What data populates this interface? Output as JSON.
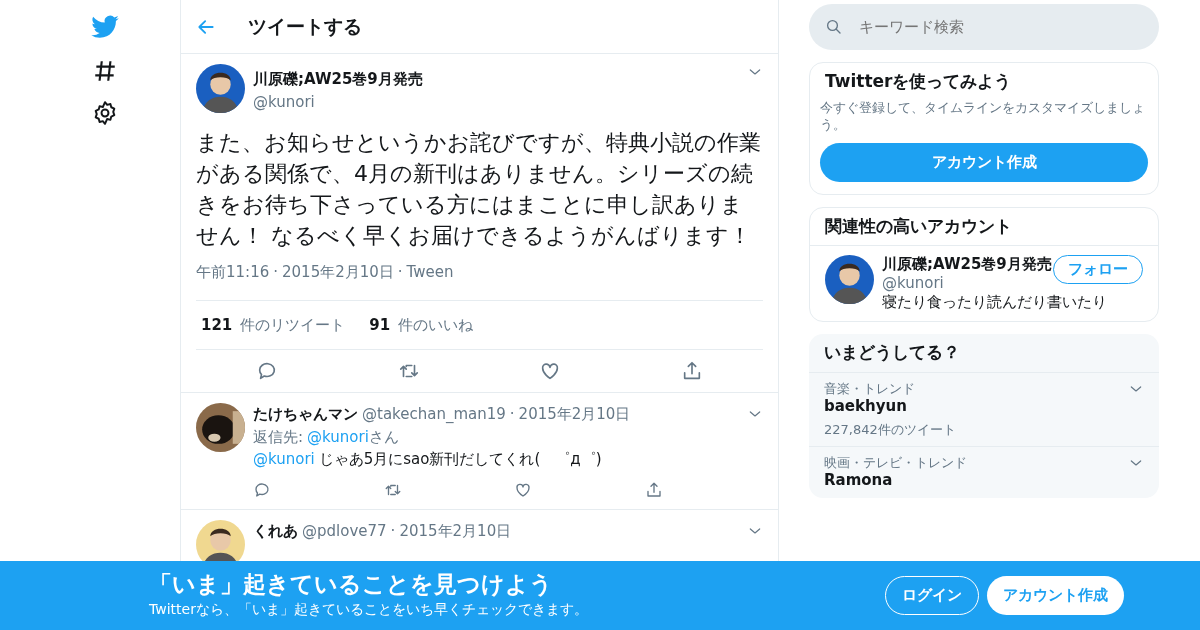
{
  "header": {
    "title": "ツイートする"
  },
  "separator": "·",
  "tweet": {
    "name": "川原礫;AW25巻9月発売",
    "handle": "@kunori",
    "text": "また、お知らせというかお詫びですが、特典小説の作業がある関係で、4月の新刊はありません。シリーズの続きをお待ち下さっている方にはまことに申し訳ありません！ なるべく早くお届けできるようがんばります！",
    "meta": [
      "午前11:16",
      "2015年2月10日",
      "Tween"
    ],
    "stats": [
      {
        "count": "121",
        "label": "件のリツイート"
      },
      {
        "count": "91",
        "label": "件のいいね"
      }
    ]
  },
  "replies": [
    {
      "name": "たけちゃんマン",
      "handle": "@takechan_man19",
      "date": "2015年2月10日",
      "reply_label": "返信先:",
      "reply_to": "@kunori",
      "reply_suffix": "さん",
      "mention": "@kunori",
      "text": "じゃあ5月にsao新刊だしてくれ(　゜д゜)"
    },
    {
      "name": "くれあ",
      "handle": "@pdlove77",
      "date": "2015年2月10日"
    }
  ],
  "search": {
    "placeholder": "キーワード検索"
  },
  "signup": {
    "title": "Twitterを使ってみよう",
    "text": "今すぐ登録して、タイムラインをカスタマイズしましょう。",
    "button": "アカウント作成"
  },
  "related": {
    "title": "関連性の高いアカウント",
    "accounts": [
      {
        "name": "川原礫;AW25巻9月発売",
        "handle": "@kunori",
        "bio": "寝たり食ったり読んだり書いたり",
        "button": "フォロー"
      }
    ]
  },
  "trends": {
    "title": "いまどうしてる？",
    "items": [
      {
        "context": "音楽・トレンド",
        "name": "baekhyun",
        "count": "227,842件のツイート"
      },
      {
        "context": "映画・テレビ・トレンド",
        "name": "Ramona"
      }
    ]
  },
  "banner": {
    "title": "「いま」起きていることを見つけよう",
    "text": "Twitterなら、「いま」起きていることをいち早くチェックできます。",
    "buttons": [
      {
        "label": "ログイン",
        "kind": "outline"
      },
      {
        "label": "アカウント作成",
        "kind": "solid"
      }
    ]
  }
}
